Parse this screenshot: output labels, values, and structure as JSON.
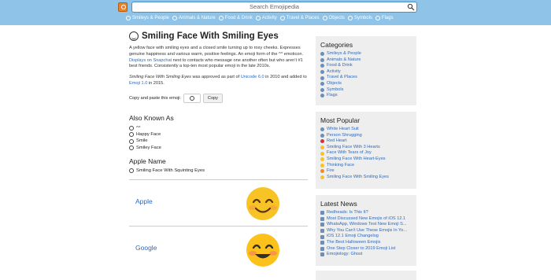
{
  "header": {
    "search_placeholder": "Search Emojipedia",
    "nav": [
      "Smileys & People",
      "Animals & Nature",
      "Food & Drink",
      "Activity",
      "Travel & Places",
      "Objects",
      "Symbols",
      "Flags"
    ]
  },
  "main": {
    "title": "Smiling Face With Smiling Eyes",
    "description_1": "A yellow face with smiling eyes and a closed smile turning up to rosy cheeks. Expresses genuine happiness and various warm, positive feelings. An emoji form of the ^^ emoticon.",
    "description_link": "Displays on Snapchat",
    "description_2": "next to contacts who message one another often but who aren’t #1 best friends. Consistently a top-ten most popular emoji in the late 2010s.",
    "approved_italic": "Smiling Face With Smiling Eyes",
    "approved_text_1": "was approved as part of",
    "approved_link_1": "Unicode 6.0",
    "approved_text_2": "in 2010 and added to",
    "approved_link_2": "Emoji 1.0",
    "approved_text_3": "in 2015.",
    "copy_label": "Copy and paste this emoji:",
    "copy_button": "Copy",
    "aka_heading": "Also Known As",
    "aka": [
      "^^",
      "Happy Face",
      "Smile",
      "Smiley Face"
    ],
    "apple_heading": "Apple Name",
    "apple_name": "Smiling Face With Squinting Eyes",
    "vendors": [
      "Apple",
      "Google"
    ]
  },
  "sidebar": {
    "categories_heading": "Categories",
    "categories": [
      "Smileys & People",
      "Animals & Nature",
      "Food & Drink",
      "Activity",
      "Travel & Places",
      "Objects",
      "Symbols",
      "Flags"
    ],
    "popular_heading": "Most Popular",
    "popular": [
      "White Heart Suit",
      "Person Shrugging",
      "Red Heart",
      "Smiling Face With 3 Hearts",
      "Face With Tears of Joy",
      "Smiling Face With Heart-Eyes",
      "Thinking Face",
      "Fire",
      "Smiling Face With Smiling Eyes"
    ],
    "news_heading": "Latest News",
    "news": [
      "Redheads: Is This It?",
      "Most Discussed New Emojis of iOS 12.1",
      "WhatsApp, Windows Test New Emoji S...",
      "Why You Can't Use These Emojis In Yo...",
      "iOS 12.1 Emoji Changelog",
      "The Best Halloween Emojis",
      "One Step Closer to 2019 Emoji List",
      "Emojiology: Ghost"
    ]
  },
  "colors": {
    "header": "#8fc3e8",
    "link": "#2a6bbf",
    "sidebar": "#eeeeee",
    "emoji": "#f7c325"
  }
}
